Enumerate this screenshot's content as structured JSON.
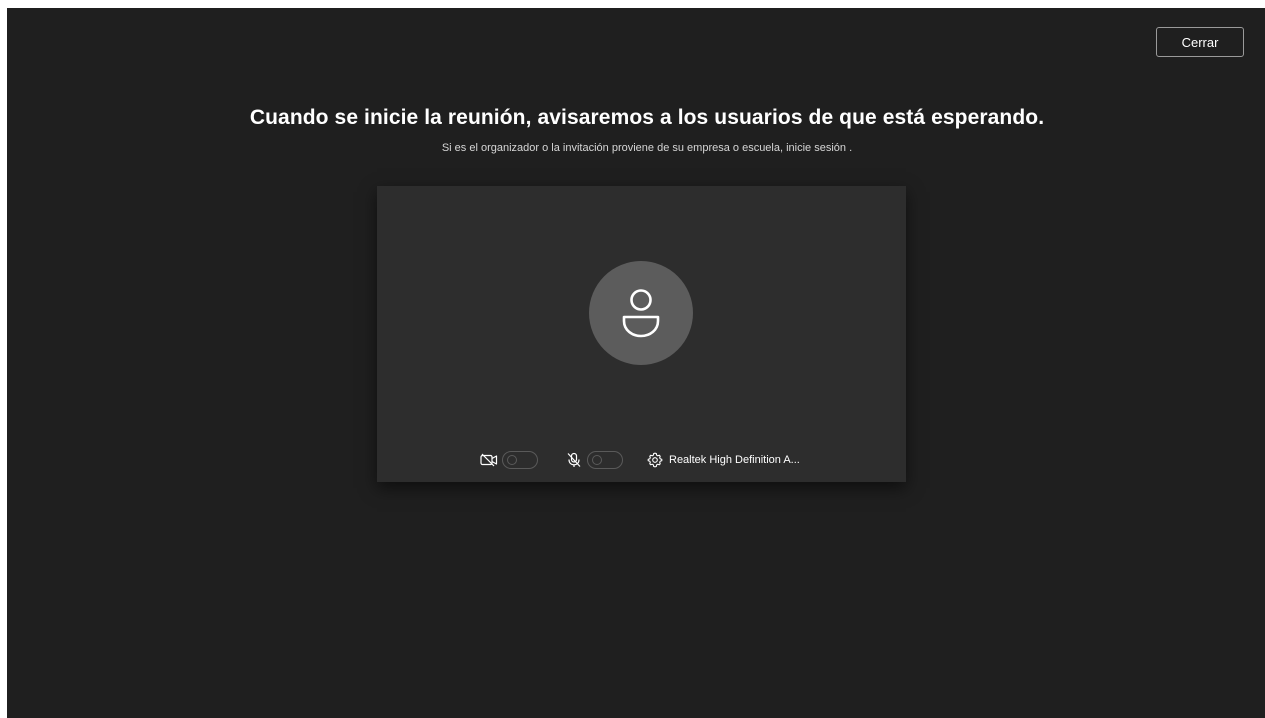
{
  "header": {
    "close_label": "Cerrar"
  },
  "main": {
    "title": "Cuando se inicie la reunión, avisaremos a los usuarios de que está esperando.",
    "subtitle": "Si es el organizador o la invitación proviene de su empresa o escuela, inicie sesión ."
  },
  "preview": {
    "avatar_icon": "person-icon",
    "camera": {
      "icon": "camera-off-icon",
      "on": false
    },
    "microphone": {
      "icon": "mic-off-icon",
      "on": false
    },
    "device": {
      "icon": "gear-icon",
      "label": "Realtek High Definition A..."
    }
  },
  "colors": {
    "background": "#1f1f1f",
    "preview_background": "#2d2d2d",
    "avatar_background": "#5c5c5c",
    "text": "#ffffff"
  }
}
